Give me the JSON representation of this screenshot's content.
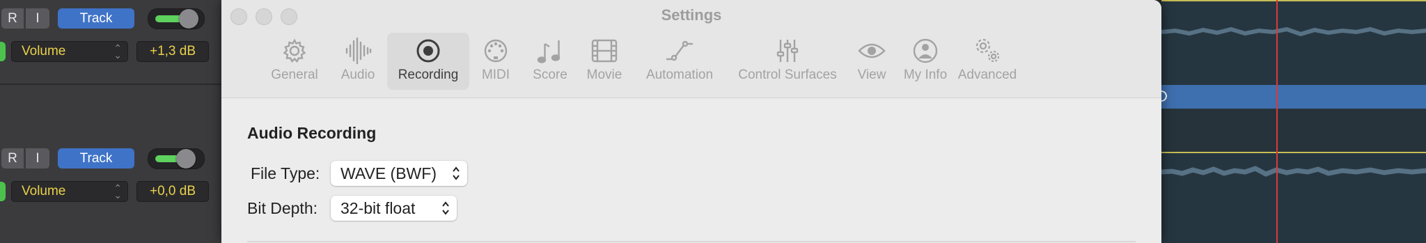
{
  "tracks": [
    {
      "record_label": "R",
      "input_label": "I",
      "track_button_label": "Track",
      "parameter": "Volume",
      "value": "+1,3 dB",
      "fader_level": 0.8
    },
    {
      "record_label": "R",
      "input_label": "I",
      "track_button_label": "Track",
      "parameter": "Volume",
      "value": "+0,0 dB",
      "fader_level": 0.77
    }
  ],
  "settings": {
    "title": "Settings",
    "tabs": [
      {
        "label": "General",
        "icon": "gear-icon"
      },
      {
        "label": "Audio",
        "icon": "waveform-icon"
      },
      {
        "label": "Recording",
        "icon": "record-icon",
        "active": true
      },
      {
        "label": "MIDI",
        "icon": "midi-icon"
      },
      {
        "label": "Score",
        "icon": "score-icon"
      },
      {
        "label": "Movie",
        "icon": "film-icon"
      },
      {
        "label": "Automation",
        "icon": "automation-icon"
      },
      {
        "label": "Control Surfaces",
        "icon": "sliders-icon"
      },
      {
        "label": "View",
        "icon": "eye-icon"
      },
      {
        "label": "My Info",
        "icon": "person-icon"
      },
      {
        "label": "Advanced",
        "icon": "gears-icon"
      }
    ],
    "section_title": "Audio Recording",
    "file_type": {
      "label": "File Type:",
      "value": "WAVE (BWF)"
    },
    "bit_depth": {
      "label": "Bit Depth:",
      "value": "32-bit float"
    }
  },
  "colors": {
    "track_button": "#3f73c7",
    "value_text": "#e9d14b",
    "playhead": "#d93a3a",
    "region": "#3e6fae"
  }
}
